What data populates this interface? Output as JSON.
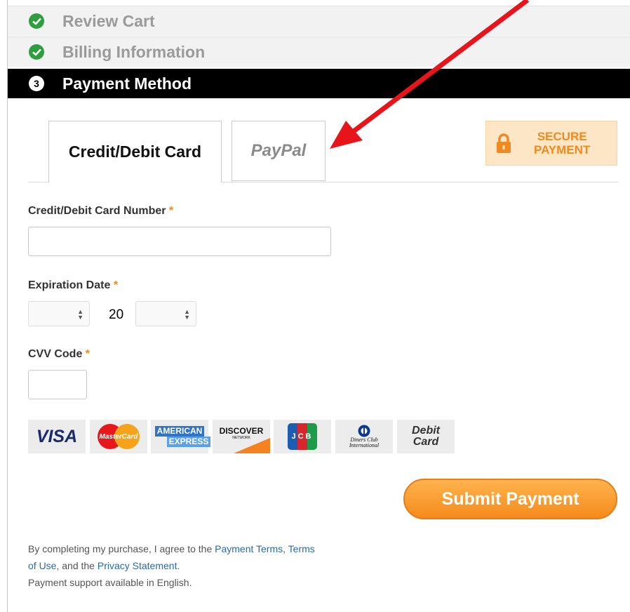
{
  "steps": [
    {
      "label": "Review Cart",
      "status": "done"
    },
    {
      "label": "Billing Information",
      "status": "done"
    },
    {
      "label": "Payment Method",
      "number": "3",
      "status": "active"
    }
  ],
  "tabs": {
    "card": "Credit/Debit Card",
    "paypal": "PayPal"
  },
  "secure": {
    "line1": "SECURE",
    "line2": "PAYMENT"
  },
  "form": {
    "card_number_label": "Credit/Debit Card Number",
    "expiration_label": "Expiration Date",
    "year_prefix": "20",
    "cvv_label": "CVV Code",
    "required_mark": "*"
  },
  "card_logos": {
    "visa": "VISA",
    "mastercard": "MasterCard",
    "amex1": "AMERICAN",
    "amex2": "EXPRESS",
    "discover": "DISCOVER",
    "discover_sub": "NETWORK",
    "jcb": "JCB",
    "diners1": "Diners Club",
    "diners2": "International",
    "debit1": "Debit",
    "debit2": "Card"
  },
  "submit_label": "Submit Payment",
  "terms": {
    "t1": "By completing my purchase, I agree to the ",
    "link1": "Payment Terms",
    "t2": ", ",
    "link2": "Terms of Use",
    "t3": ", and the ",
    "link3": "Privacy Statement",
    "t4": ".",
    "t5": "Payment support available in English."
  },
  "colors": {
    "accent": "#f08a1e",
    "check": "#2e9e3e",
    "arrow": "#e8141b",
    "link": "#2a6aad"
  }
}
